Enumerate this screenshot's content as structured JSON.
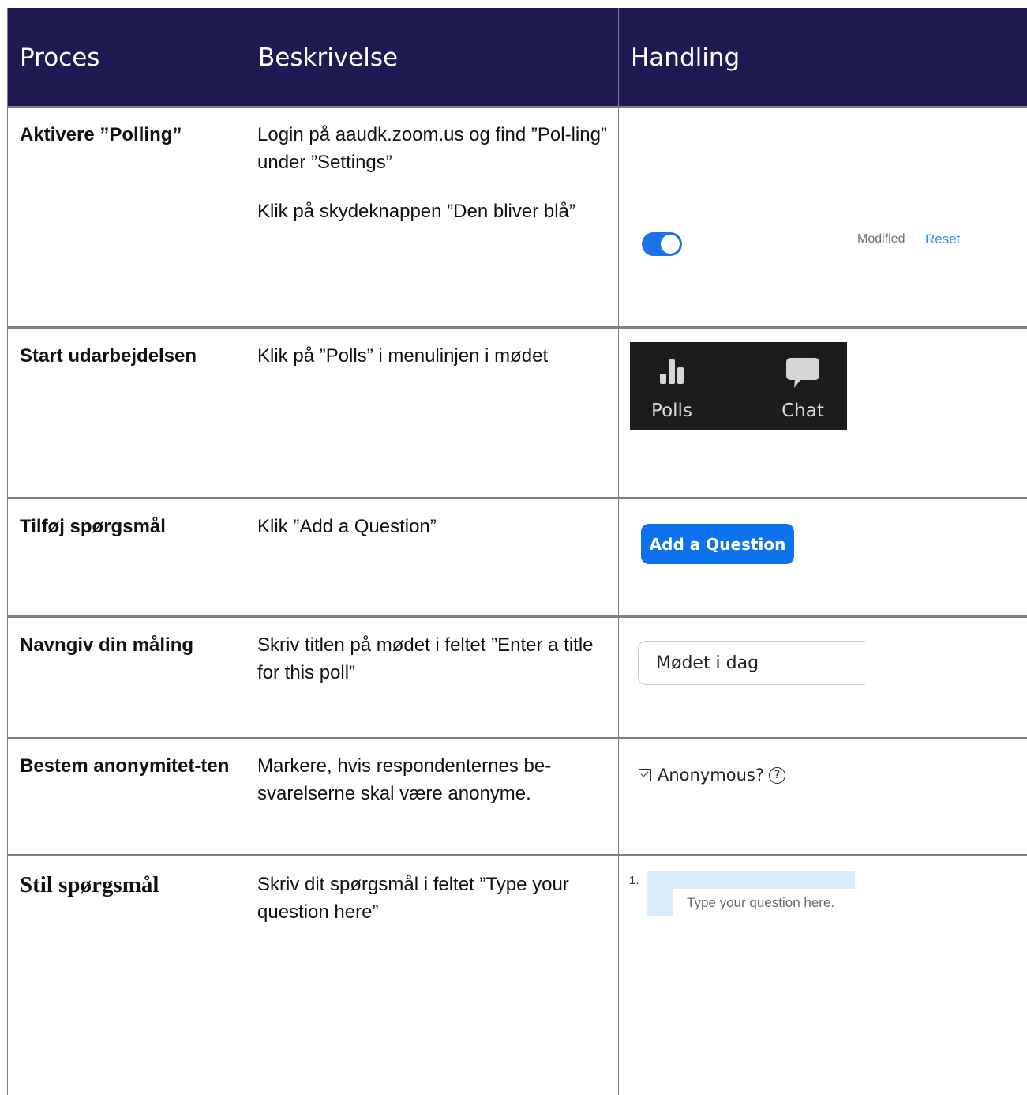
{
  "header": {
    "col1": "Proces",
    "col2": "Beskrivelse",
    "col3": "Handling"
  },
  "rows": [
    {
      "proces": "Aktivere ”Polling”",
      "desc": [
        "Login på aaudk.zoom.us og find ”Pol-ling” under ”Settings”",
        "Klik på skydeknappen ”Den bliver blå”"
      ],
      "action": {
        "toggle": "on",
        "modified": "Modified",
        "reset": "Reset",
        "accent": "#1a73e8"
      }
    },
    {
      "proces": "Start udarbejdelsen",
      "desc": [
        "Klik på ”Polls” i menulinjen i mødet"
      ],
      "action": {
        "polls_label": "Polls",
        "chat_label": "Chat",
        "polls_icon": "bar-chart-icon",
        "chat_icon": "chat-bubble-icon"
      }
    },
    {
      "proces": "Tilføj spørgsmål",
      "desc": [
        "Klik ”Add a Question”"
      ],
      "action": {
        "button": "Add a Question",
        "color": "#0e72ed"
      }
    },
    {
      "proces": "Navngiv din måling",
      "desc": [
        "Skriv titlen på mødet i feltet ”Enter a title for this poll”"
      ],
      "action": {
        "input_value": "Mødet i dag"
      }
    },
    {
      "proces": "Bestem anonymitet-ten",
      "desc": [
        "Markere, hvis respondenternes be-svarelserne skal være anonyme."
      ],
      "action": {
        "label": "Anonymous?",
        "checked": true,
        "help": "?"
      }
    },
    {
      "proces": "Stil spørgsmål",
      "desc": [
        "Skriv dit spørgsmål i feltet ”Type your question here”"
      ],
      "action": {
        "number": "1.",
        "placeholder": "Type your question here."
      }
    }
  ]
}
